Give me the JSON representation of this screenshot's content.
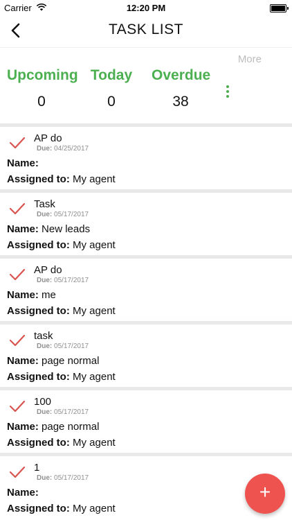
{
  "status_bar": {
    "carrier": "Carrier",
    "time": "12:20 PM"
  },
  "nav": {
    "title": "TASK LIST",
    "back_icon": "chevron-left-icon"
  },
  "stats": {
    "more_label": "More",
    "upcoming": {
      "label": "Upcoming",
      "count": "0"
    },
    "today": {
      "label": "Today",
      "count": "0"
    },
    "overdue": {
      "label": "Overdue",
      "count": "38"
    },
    "accent_color": "#4CAF50"
  },
  "labels": {
    "due": "Due:",
    "name": "Name:",
    "assigned": "Assigned to:"
  },
  "tasks": [
    {
      "title": "AP do",
      "due": "04/25/2017",
      "name": "",
      "assigned_to": "My agent"
    },
    {
      "title": "Task",
      "due": "05/17/2017",
      "name": "New leads",
      "assigned_to": "My agent"
    },
    {
      "title": "AP do",
      "due": "05/17/2017",
      "name": "me",
      "assigned_to": "My agent"
    },
    {
      "title": "task",
      "due": "05/17/2017",
      "name": "page normal",
      "assigned_to": "My agent"
    },
    {
      "title": "100",
      "due": "05/17/2017",
      "name": "page normal",
      "assigned_to": "My agent"
    },
    {
      "title": "1",
      "due": "05/17/2017",
      "name": "",
      "assigned_to": "My agent"
    }
  ],
  "fab": {
    "label": "+",
    "color": "#EF5350"
  },
  "colors": {
    "check": "#D9534F",
    "divider": "#e9e9e9"
  }
}
